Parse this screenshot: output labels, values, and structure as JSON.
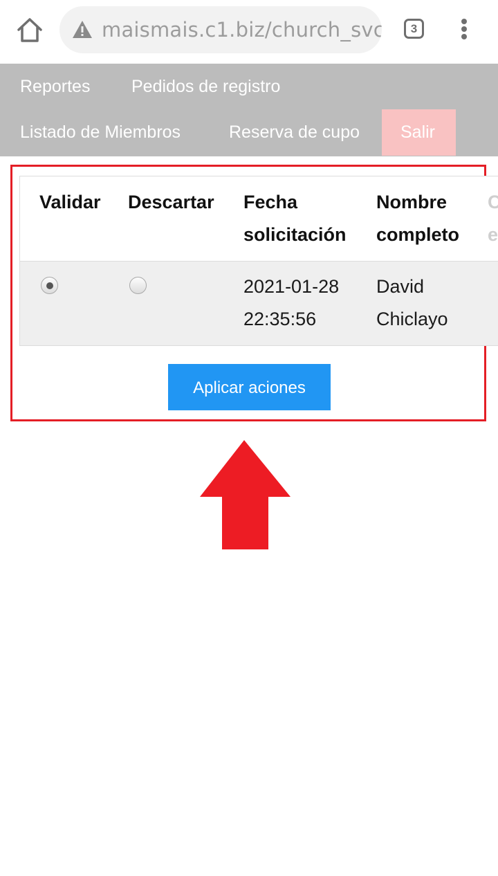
{
  "browser": {
    "url": "maismais.c1.biz/church_svc",
    "tab_count": "3",
    "icons": [
      "home-icon",
      "warning-icon",
      "tabs-icon",
      "more-vert-icon"
    ]
  },
  "nav": {
    "items": [
      "Reportes",
      "Pedidos de registro",
      "Listado de Miembros",
      "Reserva de cupo",
      "Salir"
    ]
  },
  "table": {
    "headers": {
      "validar": "Validar",
      "descartar": "Descartar",
      "fecha_line1": "Fecha",
      "fecha_line2": "solicitación",
      "nombre_line1": "Nombre",
      "nombre_line2": "completo",
      "cut_line1": "C",
      "cut_line2": "e"
    },
    "rows": [
      {
        "validar_selected": true,
        "descartar_selected": false,
        "fecha_line1": "2021-01-28",
        "fecha_line2": "22:35:56",
        "nombre_line1": "David",
        "nombre_line2": "Chiclayo"
      }
    ]
  },
  "actions": {
    "apply_label": "Aplicar aciones"
  },
  "colors": {
    "nav_bg": "#bcbcbc",
    "salir_bg": "#f9c2c2",
    "button_bg": "#2196f3",
    "highlight": "#e41e26",
    "arrow": "#ed1c24"
  }
}
